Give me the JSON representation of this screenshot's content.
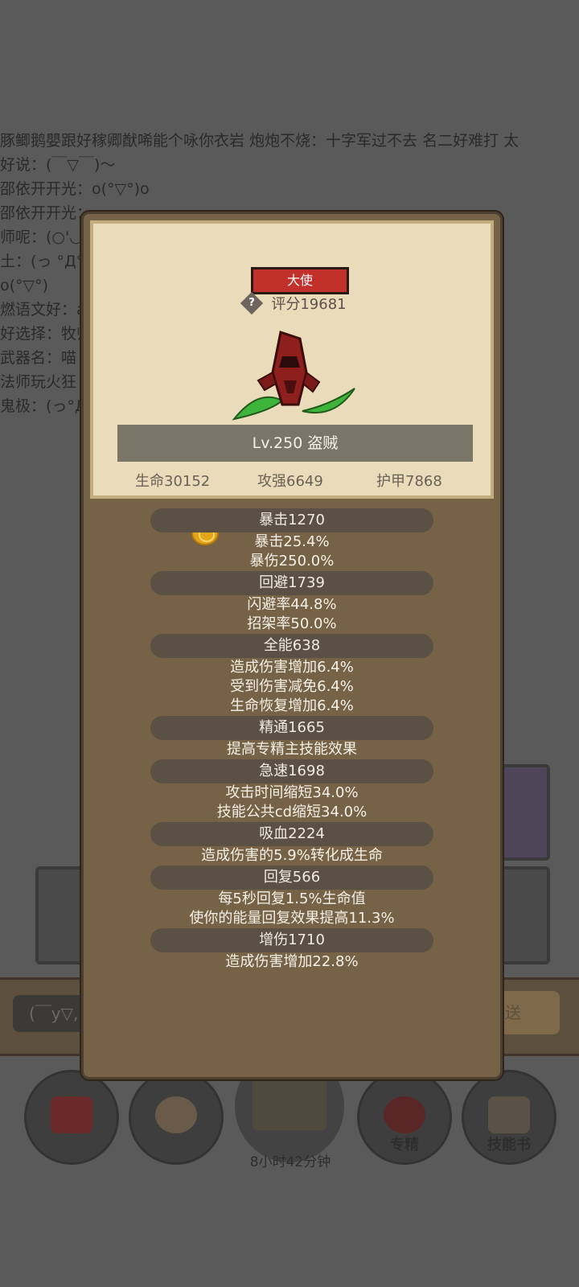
{
  "background": {
    "chat_lines": [
      "豚鲫鹅嬰跟好稼卿猷唏能个咏你衣岩 炮炮不烧：十字军过不去 名二好难打 太",
      "好说：(￣▽￣)～",
      "邵依开开光：o(°▽°)o",
      "邵依开开光：",
      "师呢：(○'◡'",
      "土：(っ °Д°",
      "o(°▽°)",
      "燃语文好：a",
      "好选择：牧师",
      "武器名：喵",
      "法师玩火狂",
      "鬼极：(っ°Д°"
    ],
    "input_text": "(￣y▽,",
    "send_label": "发送",
    "bottom_nav": [
      {
        "icon": "potion-icon",
        "label": ""
      },
      {
        "icon": "bread-icon",
        "label": ""
      },
      {
        "icon": "chest-icon",
        "label": ""
      },
      {
        "icon": "specialization-icon",
        "label": "专精"
      },
      {
        "icon": "skill-book-icon",
        "label": "技能书"
      }
    ],
    "timer": "8小时42分钟"
  },
  "modal": {
    "title_badge": "大使",
    "score_icon": "?",
    "score": "评分19681",
    "level_class": "Lv.250 盗贼",
    "base_stats": [
      "生命30152",
      "攻强6649",
      "护甲7868"
    ],
    "coin_icon": "gold-coin-icon",
    "stats": [
      {
        "name": "暴击1270",
        "details": [
          "暴击25.4%",
          "暴伤250.0%"
        ]
      },
      {
        "name": "回避1739",
        "details": [
          "闪避率44.8%",
          "招架率50.0%"
        ]
      },
      {
        "name": "全能638",
        "details": [
          "造成伤害增加6.4%",
          "受到伤害减免6.4%",
          "生命恢复增加6.4%"
        ]
      },
      {
        "name": "精通1665",
        "details": [
          "提高专精主技能效果"
        ]
      },
      {
        "name": "急速1698",
        "details": [
          "攻击时间缩短34.0%",
          "技能公共cd缩短34.0%"
        ]
      },
      {
        "name": "吸血2224",
        "details": [
          "造成伤害的5.9%转化成生命"
        ]
      },
      {
        "name": "回复566",
        "details": [
          "每5秒回复1.5%生命值",
          "使你的能量回复效果提高11.3%"
        ]
      },
      {
        "name": "增伤1710",
        "details": [
          "造成伤害增加22.8%"
        ]
      }
    ]
  }
}
